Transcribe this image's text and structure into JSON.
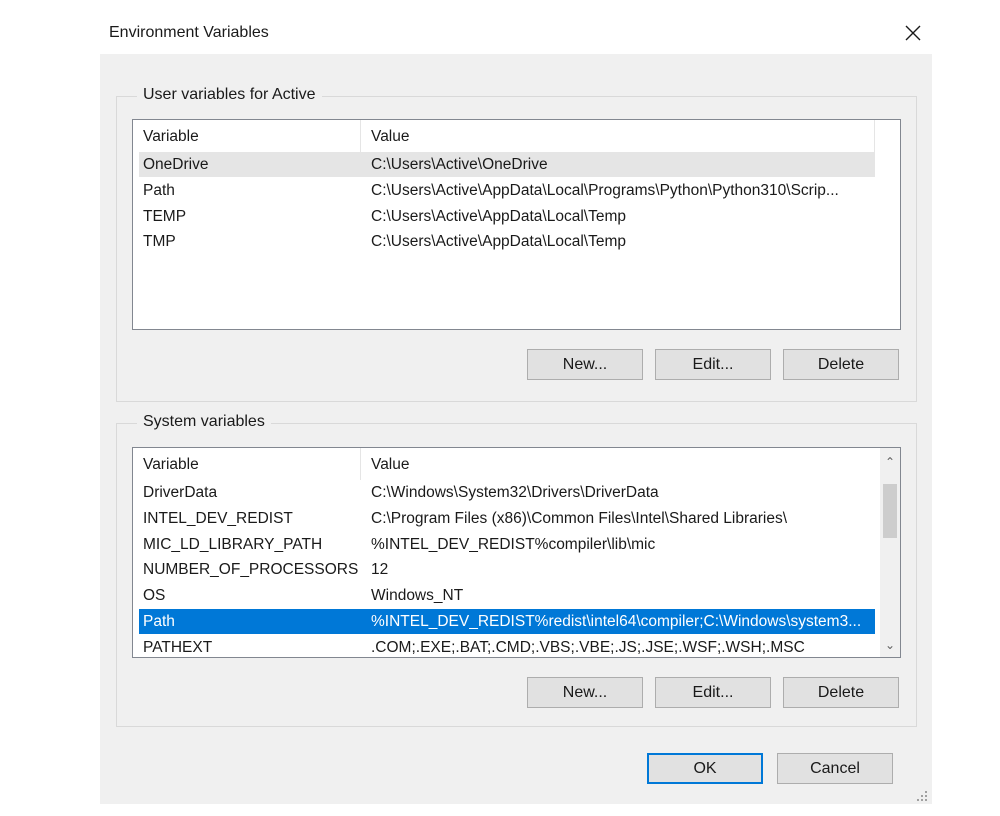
{
  "window": {
    "title": "Environment Variables"
  },
  "user_group": {
    "label": "User variables for Active",
    "columns": [
      "Variable",
      "Value"
    ],
    "rows": [
      {
        "name": "OneDrive",
        "value": "C:\\Users\\Active\\OneDrive"
      },
      {
        "name": "Path",
        "value": "C:\\Users\\Active\\AppData\\Local\\Programs\\Python\\Python310\\Scrip..."
      },
      {
        "name": "TEMP",
        "value": "C:\\Users\\Active\\AppData\\Local\\Temp"
      },
      {
        "name": "TMP",
        "value": "C:\\Users\\Active\\AppData\\Local\\Temp"
      }
    ],
    "hover_row": 0,
    "buttons": {
      "new": "New...",
      "edit": "Edit...",
      "delete": "Delete"
    }
  },
  "system_group": {
    "label": "System variables",
    "columns": [
      "Variable",
      "Value"
    ],
    "rows": [
      {
        "name": "DriverData",
        "value": "C:\\Windows\\System32\\Drivers\\DriverData"
      },
      {
        "name": "INTEL_DEV_REDIST",
        "value": "C:\\Program Files (x86)\\Common Files\\Intel\\Shared Libraries\\"
      },
      {
        "name": "MIC_LD_LIBRARY_PATH",
        "value": "%INTEL_DEV_REDIST%compiler\\lib\\mic"
      },
      {
        "name": "NUMBER_OF_PROCESSORS",
        "value": "12"
      },
      {
        "name": "OS",
        "value": "Windows_NT"
      },
      {
        "name": "Path",
        "value": "%INTEL_DEV_REDIST%redist\\intel64\\compiler;C:\\Windows\\system3..."
      },
      {
        "name": "PATHEXT",
        "value": ".COM;.EXE;.BAT;.CMD;.VBS;.VBE;.JS;.JSE;.WSF;.WSH;.MSC"
      }
    ],
    "selected_row": 5,
    "buttons": {
      "new": "New...",
      "edit": "Edit...",
      "delete": "Delete"
    }
  },
  "footer": {
    "ok": "OK",
    "cancel": "Cancel"
  },
  "colors": {
    "selection": "#0078d7",
    "hover": "#e5e5e5",
    "dialog_bg": "#f0f0f0"
  },
  "icons": {
    "close": "close-icon",
    "scroll_up": "chevron-up-icon",
    "scroll_down": "chevron-down-icon",
    "resize": "resize-grip-icon"
  }
}
